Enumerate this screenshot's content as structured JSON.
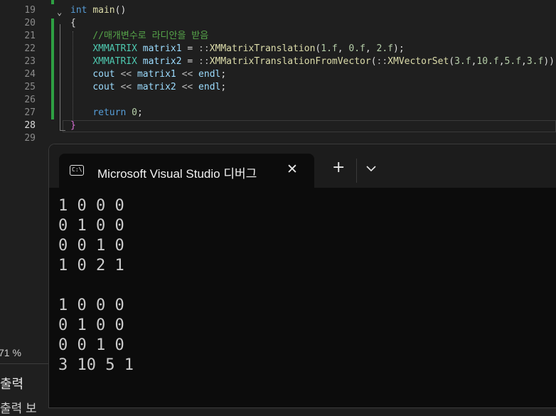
{
  "editor": {
    "lines": [
      {
        "num": "19",
        "tokens": [
          [
            "kw",
            "int"
          ],
          [
            "pn",
            " "
          ],
          [
            "fn",
            "main"
          ],
          [
            "pn",
            "()"
          ]
        ]
      },
      {
        "num": "20",
        "tokens": [
          [
            "pn",
            "{"
          ]
        ]
      },
      {
        "num": "21",
        "tokens": [
          [
            "cm",
            "    //매개변수로 라디안을 받음"
          ]
        ]
      },
      {
        "num": "22",
        "tokens": [
          [
            "pn",
            "    "
          ],
          [
            "ty",
            "XMMATRIX"
          ],
          [
            "pn",
            " "
          ],
          [
            "var",
            "matrix1"
          ],
          [
            "pn",
            " = "
          ],
          [
            "op",
            "::"
          ],
          [
            "fn",
            "XMMatrixTranslation"
          ],
          [
            "pn",
            "("
          ],
          [
            "num",
            "1.f"
          ],
          [
            "pn",
            ", "
          ],
          [
            "num",
            "0.f"
          ],
          [
            "pn",
            ", "
          ],
          [
            "num",
            "2.f"
          ],
          [
            "pn",
            ");"
          ]
        ]
      },
      {
        "num": "23",
        "tokens": [
          [
            "pn",
            "    "
          ],
          [
            "ty",
            "XMMATRIX"
          ],
          [
            "pn",
            " "
          ],
          [
            "var",
            "matrix2"
          ],
          [
            "pn",
            " = "
          ],
          [
            "op",
            "::"
          ],
          [
            "fn",
            "XMMatrixTranslationFromVector"
          ],
          [
            "pn",
            "("
          ],
          [
            "op",
            "::"
          ],
          [
            "fn",
            "XMVectorSet"
          ],
          [
            "pn",
            "("
          ],
          [
            "num",
            "3.f"
          ],
          [
            "pn",
            ","
          ],
          [
            "num",
            "10.f"
          ],
          [
            "pn",
            ","
          ],
          [
            "num",
            "5.f"
          ],
          [
            "pn",
            ","
          ],
          [
            "num",
            "3.f"
          ],
          [
            "pn",
            "));"
          ]
        ]
      },
      {
        "num": "24",
        "tokens": [
          [
            "pn",
            "    "
          ],
          [
            "var",
            "cout"
          ],
          [
            "pn",
            " "
          ],
          [
            "op",
            "<<"
          ],
          [
            "pn",
            " "
          ],
          [
            "var",
            "matrix1"
          ],
          [
            "pn",
            " "
          ],
          [
            "op",
            "<<"
          ],
          [
            "pn",
            " "
          ],
          [
            "var",
            "endl"
          ],
          [
            "pn",
            ";"
          ]
        ]
      },
      {
        "num": "25",
        "tokens": [
          [
            "pn",
            "    "
          ],
          [
            "var",
            "cout"
          ],
          [
            "pn",
            " "
          ],
          [
            "op",
            "<<"
          ],
          [
            "pn",
            " "
          ],
          [
            "var",
            "matrix2"
          ],
          [
            "pn",
            " "
          ],
          [
            "op",
            "<<"
          ],
          [
            "pn",
            " "
          ],
          [
            "var",
            "endl"
          ],
          [
            "pn",
            ";"
          ]
        ]
      },
      {
        "num": "26",
        "tokens": []
      },
      {
        "num": "27",
        "tokens": [
          [
            "pn",
            "    "
          ],
          [
            "kw",
            "return"
          ],
          [
            "pn",
            " "
          ],
          [
            "num",
            "0"
          ],
          [
            "pn",
            ";"
          ]
        ]
      },
      {
        "num": "28",
        "tokens": [
          [
            "pk",
            "}"
          ]
        ]
      },
      {
        "num": "29",
        "tokens": []
      }
    ],
    "current_line": "28"
  },
  "left_panel": {
    "zoom": "71 %",
    "output_label": "출력",
    "output_label_partial": "출력 보"
  },
  "console": {
    "tab_title": "Microsoft Visual Studio 디버그",
    "icon_text": "C:\\",
    "close_glyph": "✕",
    "new_tab_glyph": "+",
    "output_lines": [
      "1 0 0 0",
      "0 1 0 0",
      "0 0 1 0",
      "1 0 2 1",
      "",
      "1 0 0 0",
      "0 1 0 0",
      "0 0 1 0",
      "3 10 5 1"
    ]
  }
}
